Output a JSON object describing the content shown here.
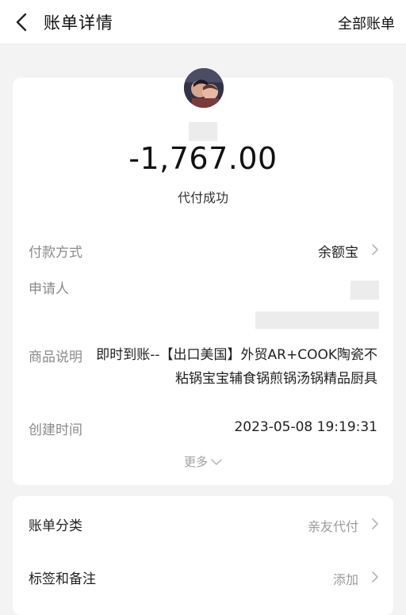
{
  "header": {
    "title": "账单详情",
    "right_action": "全部账单"
  },
  "summary": {
    "amount": "-1,767.00",
    "status": "代付成功"
  },
  "details": {
    "payment_method_label": "付款方式",
    "payment_method_value": "余额宝",
    "applicant_label": "申请人",
    "description_label": "商品说明",
    "description_value": "即时到账--【出口美国】外贸AR+COOK陶瓷不粘锅宝宝辅食锅煎锅汤锅精品厨具",
    "created_label": "创建时间",
    "created_value": "2023-05-08 19:19:31",
    "more_label": "更多"
  },
  "secondary": {
    "category_label": "账单分类",
    "category_value": "亲友代付",
    "tags_label": "标签和备注",
    "tags_value": "添加"
  },
  "icons": {
    "back": "back-arrow-icon",
    "chevron_right": "chevron-right-icon",
    "chevron_down": "chevron-down-icon"
  }
}
